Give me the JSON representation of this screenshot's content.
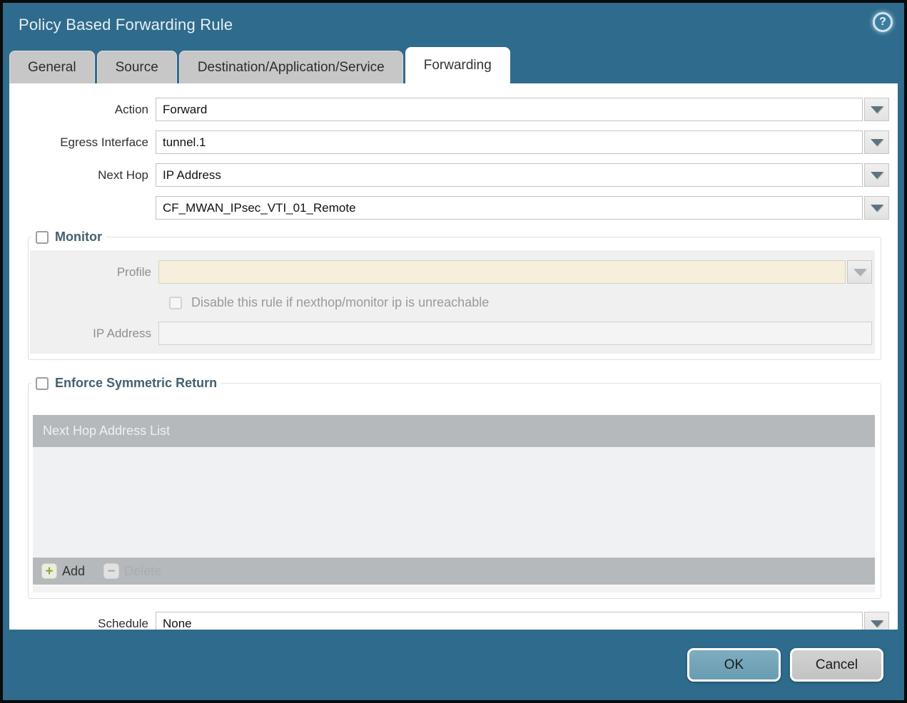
{
  "dialog": {
    "title": "Policy Based Forwarding Rule"
  },
  "icons": {
    "help": "?",
    "add": "+",
    "delete": "−"
  },
  "tabs": [
    {
      "label": "General",
      "active": false
    },
    {
      "label": "Source",
      "active": false
    },
    {
      "label": "Destination/Application/Service",
      "active": false
    },
    {
      "label": "Forwarding",
      "active": true
    }
  ],
  "form": {
    "action": {
      "label": "Action",
      "value": "Forward"
    },
    "egress_interface": {
      "label": "Egress Interface",
      "value": "tunnel.1"
    },
    "next_hop": {
      "label": "Next Hop",
      "value": "IP Address"
    },
    "next_hop_address": {
      "value": "CF_MWAN_IPsec_VTI_01_Remote"
    },
    "schedule": {
      "label": "Schedule",
      "value": "None"
    }
  },
  "monitor": {
    "label": "Monitor",
    "checked": false,
    "profile": {
      "label": "Profile",
      "value": ""
    },
    "disable_rule": {
      "label": "Disable this rule if nexthop/monitor ip is unreachable",
      "checked": false
    },
    "ip_address": {
      "label": "IP Address",
      "value": ""
    }
  },
  "enforce_symmetric_return": {
    "label": "Enforce Symmetric Return",
    "checked": false,
    "table": {
      "header": "Next Hop Address List",
      "rows": []
    },
    "add_label": "Add",
    "delete_label": "Delete"
  },
  "footer": {
    "ok_label": "OK",
    "cancel_label": "Cancel"
  },
  "colors": {
    "titlebar": "#2f6b8c",
    "ok_button": "#6f9fb4",
    "table_header": "#b5b9bc",
    "profile_disabled_bg": "#f5efdb"
  }
}
